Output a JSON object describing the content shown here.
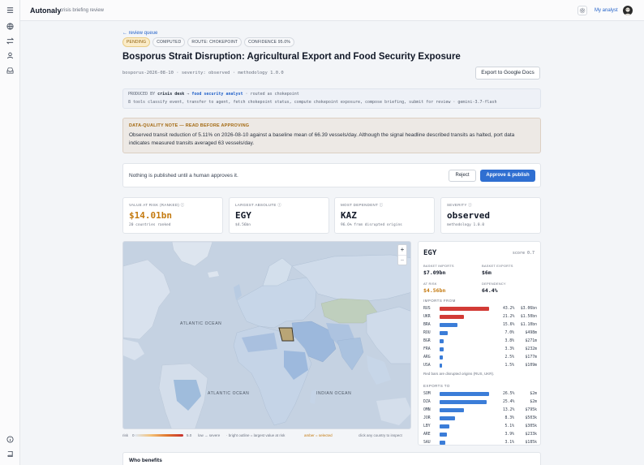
{
  "app": {
    "brand": "Autonaly",
    "subtitle": "crisis briefing review",
    "user_link": "My analyst"
  },
  "rail_icons": [
    "menu-icon",
    "globe-icon",
    "swap-icon",
    "user-icon",
    "inbox-icon",
    "info-icon",
    "book-icon"
  ],
  "back_link": "← review queue",
  "badges": [
    "PENDING",
    "COMPUTED",
    "ROUTE: CHOKEPOINT",
    "CONFIDENCE 95.0%"
  ],
  "title": "Bosporus Strait Disruption: Agricultural Export and Food Security Exposure",
  "meta": "bosporus-2026-08-10 · severity: observed · methodology 1.0.0",
  "export_button": "Export to Google Docs",
  "produced": {
    "prefix": "PRODUCED BY",
    "desk": "crisis desk",
    "arrow": "→",
    "agent": "food security analyst",
    "routed": "· routed as chokepoint",
    "tools": "8 tools classify event, transfer to agent, fetch chokepoint status, compute chokepoint exposure, compose briefing, submit for review · gemini-3.7-flash"
  },
  "data_quality": {
    "heading": "DATA-QUALITY NOTE — READ BEFORE APPROVING",
    "body": "Observed transit reduction of 5.11% on 2026-08-10 against a baseline mean of 66.39 vessels/day. Although the signal headline described transits as halted, port data indicates measured transits averaged 63 vessels/day."
  },
  "approval": {
    "text": "Nothing is published until a human approves it.",
    "reject": "Reject",
    "approve": "Approve & publish"
  },
  "kpis": [
    {
      "label": "VALUE AT RISK (RANKED) ⓘ",
      "value": "$14.01bn",
      "sub": "20 countries ranked"
    },
    {
      "label": "LARGEST ABSOLUTE ⓘ",
      "value": "EGY",
      "sub": "$4.56bn"
    },
    {
      "label": "MOST DEPENDENT ⓘ",
      "value": "KAZ",
      "sub": "96.6% from disrupted origins"
    },
    {
      "label": "SEVERITY ⓘ",
      "value": "observed",
      "sub": "methodology 1.0.0"
    }
  ],
  "map": {
    "zoom_in": "+",
    "zoom_out": "−",
    "oceans": [
      "ATLANTIC OCEAN",
      "ATLANTIC OCEAN",
      "INDIAN OCEAN"
    ],
    "legend": {
      "risk": "risk",
      "min": "0",
      "max": "5.0",
      "scale": "low → severe",
      "outline_note": "· bright outline = largest value at risk",
      "selected_note": "amber = selected",
      "hint": "click any country to inspect"
    }
  },
  "panel": {
    "country": "EGY",
    "score": "score 0.7",
    "stats": [
      {
        "label": "BASKET IMPORTS",
        "value": "$7.09bn"
      },
      {
        "label": "BASKET EXPORTS",
        "value": "$6m"
      },
      {
        "label": "AT RISK",
        "value": "$4.56bn"
      },
      {
        "label": "DEPENDENCY",
        "value": "64.4%"
      }
    ],
    "imports_heading": "IMPORTS FROM",
    "imports": [
      {
        "code": "RUS",
        "pct": "43.2%",
        "amount": "$3.06bn",
        "share": 43.2,
        "disrupted": true
      },
      {
        "code": "UKR",
        "pct": "21.2%",
        "amount": "$1.50bn",
        "share": 21.2,
        "disrupted": true
      },
      {
        "code": "BRA",
        "pct": "15.6%",
        "amount": "$1.10bn",
        "share": 15.6,
        "disrupted": false
      },
      {
        "code": "ROU",
        "pct": "7.0%",
        "amount": "$498m",
        "share": 7.0,
        "disrupted": false
      },
      {
        "code": "BGR",
        "pct": "3.8%",
        "amount": "$271m",
        "share": 3.8,
        "disrupted": false
      },
      {
        "code": "FRA",
        "pct": "3.3%",
        "amount": "$232m",
        "share": 3.3,
        "disrupted": false
      },
      {
        "code": "ARG",
        "pct": "2.5%",
        "amount": "$177m",
        "share": 2.5,
        "disrupted": false
      },
      {
        "code": "USA",
        "pct": "1.5%",
        "amount": "$109m",
        "share": 1.5,
        "disrupted": false
      }
    ],
    "imports_note": "Red bars are disrupted origins (RUS, UKR).",
    "exports_heading": "EXPORTS TO",
    "exports": [
      {
        "code": "SOM",
        "pct": "26.5%",
        "amount": "$2m",
        "share": 26.5
      },
      {
        "code": "DZA",
        "pct": "25.4%",
        "amount": "$2m",
        "share": 25.4
      },
      {
        "code": "OMN",
        "pct": "13.2%",
        "amount": "$795k",
        "share": 13.2
      },
      {
        "code": "JOR",
        "pct": "8.3%",
        "amount": "$503k",
        "share": 8.3
      },
      {
        "code": "LBY",
        "pct": "5.1%",
        "amount": "$305k",
        "share": 5.1
      },
      {
        "code": "ARE",
        "pct": "3.9%",
        "amount": "$233k",
        "share": 3.9
      },
      {
        "code": "SAU",
        "pct": "3.1%",
        "amount": "$185k",
        "share": 3.1
      }
    ]
  },
  "who_benefits": "Who benefits",
  "colors": {
    "accent": "#2f6fd1",
    "disrupted": "#d23b36",
    "bar": "#3b7dd8",
    "amber": "#c47a10"
  }
}
